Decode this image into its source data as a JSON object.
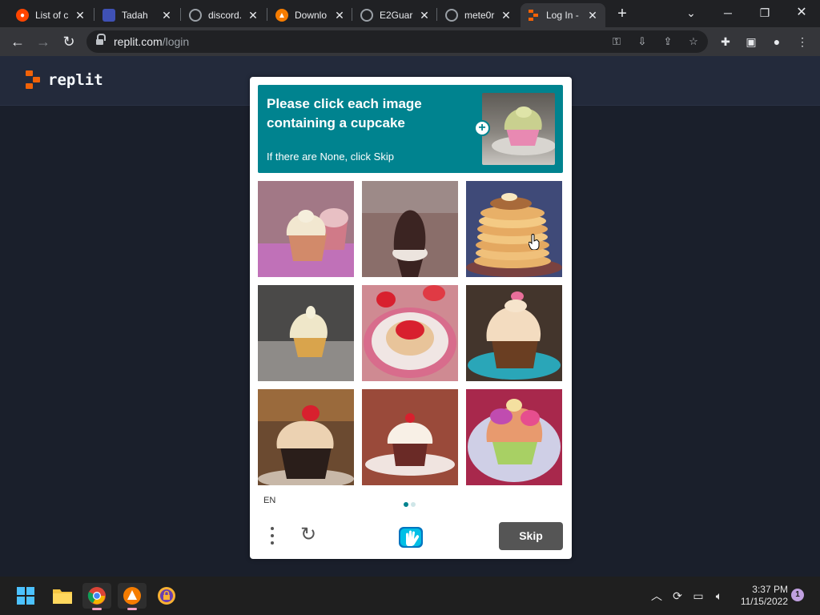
{
  "browser": {
    "tabs": [
      {
        "title": "List of c",
        "icon": "reddit-icon",
        "color": "#ff4500"
      },
      {
        "title": "Tadah",
        "icon": "figure-icon",
        "color": "#3f51b5"
      },
      {
        "title": "discord.",
        "icon": "globe-icon",
        "color": "#9aa0a6"
      },
      {
        "title": "Downlo",
        "icon": "download-site-icon",
        "color": "#f57c00"
      },
      {
        "title": "E2Guar",
        "icon": "globe-icon",
        "color": "#9aa0a6"
      },
      {
        "title": "mete0r",
        "icon": "globe-icon",
        "color": "#9aa0a6"
      },
      {
        "title": "Log In -",
        "icon": "replit-icon",
        "color": "#f26207"
      }
    ],
    "url_host": "replit.com",
    "url_path": "/login"
  },
  "page": {
    "logo_text": "replit",
    "brand_color": "#f26207"
  },
  "captcha": {
    "prompt": "Please click each image containing a cupcake",
    "subprompt": "If there are None, click Skip",
    "language": "EN",
    "skip_label": "Skip",
    "accent_color": "#00838f",
    "images": [
      {
        "subject": "cupcake"
      },
      {
        "subject": "chocolate-topped cone"
      },
      {
        "subject": "pancake stack"
      },
      {
        "subject": "cupcake"
      },
      {
        "subject": "strawberry tart"
      },
      {
        "subject": "cupcake"
      },
      {
        "subject": "cupcake with red topping"
      },
      {
        "subject": "cupcake"
      },
      {
        "subject": "colorful cupcake"
      }
    ],
    "page_dots": 2,
    "active_page": 1
  },
  "taskbar": {
    "time": "3:37 PM",
    "date": "11/15/2022",
    "notification_count": "1"
  }
}
